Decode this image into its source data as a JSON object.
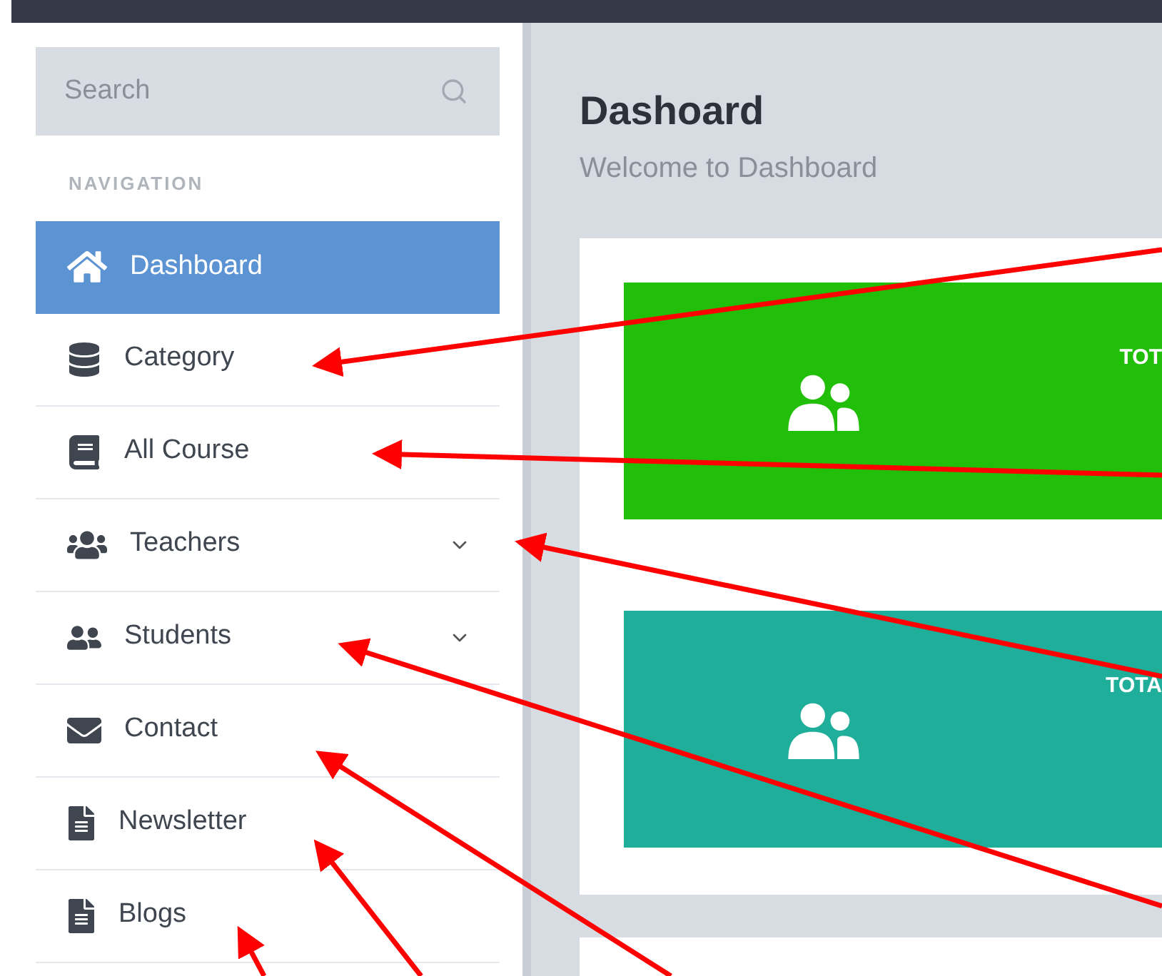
{
  "search": {
    "placeholder": "Search"
  },
  "sidebar": {
    "heading": "NAVIGATION",
    "items": [
      {
        "label": "Dashboard",
        "kind": "home",
        "selected": true,
        "expandable": false
      },
      {
        "label": "Category",
        "kind": "database",
        "selected": false,
        "expandable": false
      },
      {
        "label": "All Course",
        "kind": "book",
        "selected": false,
        "expandable": false
      },
      {
        "label": "Teachers",
        "kind": "group",
        "selected": false,
        "expandable": true
      },
      {
        "label": "Students",
        "kind": "pair",
        "selected": false,
        "expandable": true
      },
      {
        "label": "Contact",
        "kind": "mail",
        "selected": false,
        "expandable": false
      },
      {
        "label": "Newsletter",
        "kind": "file",
        "selected": false,
        "expandable": false
      },
      {
        "label": "Blogs",
        "kind": "file",
        "selected": false,
        "expandable": false
      }
    ]
  },
  "page": {
    "title": "Dashoard",
    "subtitle": "Welcome to Dashboard"
  },
  "stat_cards": [
    {
      "label": "TOT",
      "color": "#22bf0a"
    },
    {
      "label": "TOTA",
      "color": "#1eae9a"
    }
  ]
}
